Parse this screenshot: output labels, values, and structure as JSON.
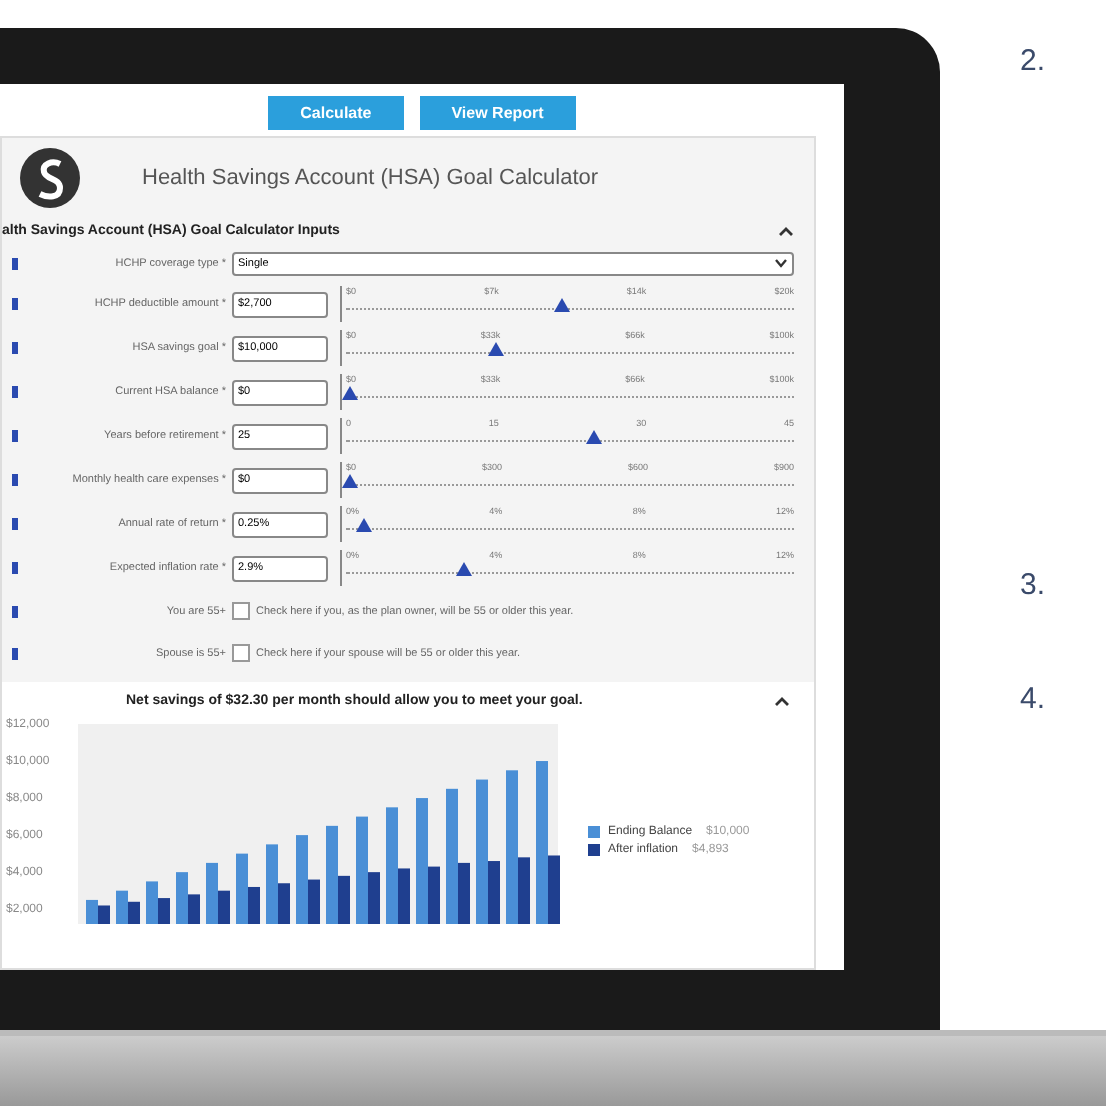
{
  "buttons": [
    {
      "label": "Calculate"
    },
    {
      "label": "View Report"
    }
  ],
  "title": "Health Savings Account (HSA) Goal Calculator",
  "inputs_section": {
    "title": "alth Savings Account (HSA) Goal Calculator Inputs",
    "expanded": true
  },
  "fields": [
    {
      "kind": "select",
      "label": "HCHP coverage type *",
      "value": "Single"
    },
    {
      "kind": "slider",
      "label": "HCHP deductible amount *",
      "value": "$2,700",
      "level": 0.48,
      "ticks": [
        "$0",
        "$7k",
        "$14k",
        "$20k"
      ]
    },
    {
      "kind": "slider",
      "label": "HSA savings goal *",
      "value": "$10,000",
      "level": 0.33,
      "ticks": [
        "$0",
        "$33k",
        "$66k",
        "$100k"
      ]
    },
    {
      "kind": "slider",
      "label": "Current HSA balance *",
      "value": "$0",
      "level": 0.01,
      "ticks": [
        "$0",
        "$33k",
        "$66k",
        "$100k"
      ]
    },
    {
      "kind": "slider",
      "label": "Years before retirement *",
      "value": "25",
      "level": 0.55,
      "ticks": [
        "0",
        "15",
        "30",
        "45"
      ]
    },
    {
      "kind": "slider",
      "label": "Monthly health care expenses *",
      "value": "$0",
      "level": 0.01,
      "ticks": [
        "$0",
        "$300",
        "$600",
        "$900"
      ]
    },
    {
      "kind": "slider",
      "label": "Annual rate of return *",
      "value": "0.25%",
      "level": 0.04,
      "ticks": [
        "0%",
        "4%",
        "8%",
        "12%"
      ]
    },
    {
      "kind": "slider",
      "label": "Expected inflation rate *",
      "value": "2.9%",
      "level": 0.26,
      "ticks": [
        "0%",
        "4%",
        "8%",
        "12%"
      ]
    },
    {
      "kind": "checkbox",
      "label": "You are 55+",
      "text": "Check here if you, as the plan owner, will be 55 or older this year.",
      "checked": false
    },
    {
      "kind": "checkbox",
      "label": "Spouse is 55+",
      "text": "Check here if your spouse will be 55 or older this year.",
      "checked": false
    }
  ],
  "results": {
    "title": "Net savings of $32.30 per month should allow you to meet your goal.",
    "expanded": true,
    "legend_values": [
      "$10,000",
      "$4,893"
    ],
    "chart_data": {
      "type": "bar",
      "stacked": false,
      "ylim": [
        1200,
        12000
      ],
      "categories": [
        null,
        null,
        null,
        null,
        null,
        null,
        null,
        null,
        null,
        null,
        null,
        null,
        null,
        null,
        null,
        null
      ],
      "yticks": [
        {
          "value": 2000,
          "label": "$2,000"
        },
        {
          "value": 4000,
          "label": "$4,000"
        },
        {
          "value": 6000,
          "label": "$6,000"
        },
        {
          "value": 8000,
          "label": "$8,000"
        },
        {
          "value": 10000,
          "label": "$10,000"
        },
        {
          "value": 12000,
          "label": "$12,000"
        }
      ],
      "series": [
        {
          "name": "Ending Balance",
          "color": "#4a8fd6",
          "values": [
            2500,
            3000,
            3500,
            4000,
            4500,
            5000,
            5500,
            6000,
            6500,
            7000,
            7500,
            8000,
            8500,
            9000,
            9500,
            10000
          ]
        },
        {
          "name": "After inflation",
          "color": "#1f3f8f",
          "values": [
            2200,
            2400,
            2600,
            2800,
            3000,
            3200,
            3400,
            3600,
            3800,
            4000,
            4200,
            4300,
            4500,
            4600,
            4800,
            4900
          ]
        }
      ]
    }
  },
  "side_numbers": [
    "2.",
    "3.",
    "4."
  ]
}
